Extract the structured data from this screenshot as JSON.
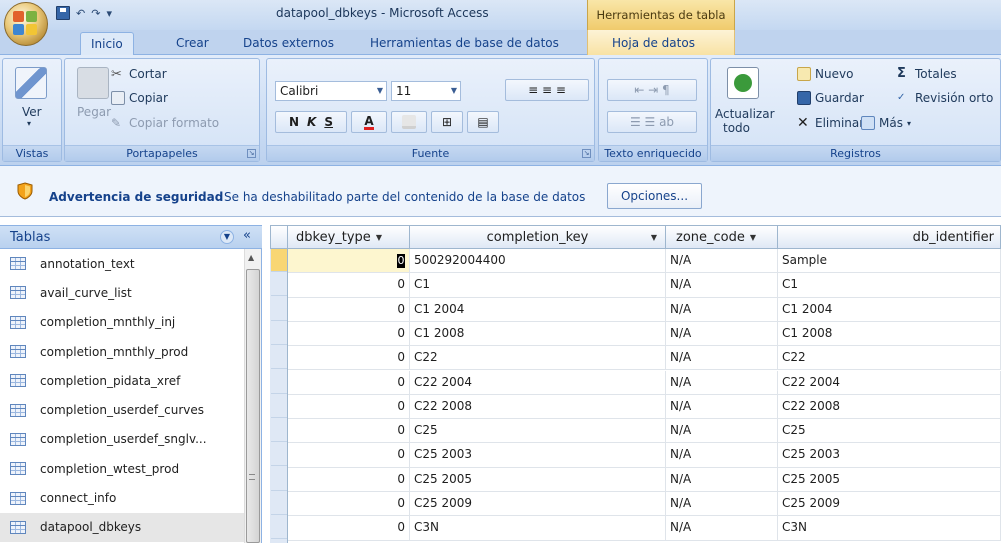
{
  "window": {
    "title": "datapool_dbkeys - Microsoft Access",
    "context_tab_title": "Herramientas de tabla"
  },
  "tabs": [
    {
      "label": "Inicio",
      "active": true
    },
    {
      "label": "Crear"
    },
    {
      "label": "Datos externos"
    },
    {
      "label": "Herramientas de base de datos"
    },
    {
      "label": "Hoja de datos"
    }
  ],
  "ribbon": {
    "vistas": {
      "label": "Vistas",
      "ver": "Ver"
    },
    "portapapeles": {
      "label": "Portapapeles",
      "pegar": "Pegar",
      "cortar": "Cortar",
      "copiar": "Copiar",
      "copiar_formato": "Copiar formato"
    },
    "fuente": {
      "label": "Fuente",
      "font": "Calibri",
      "size": "11",
      "bold": "N",
      "italic": "K",
      "underline": "S",
      "font_color": "A"
    },
    "texto": {
      "label": "Texto enriquecido"
    },
    "registros": {
      "label": "Registros",
      "actualizar": "Actualizar",
      "todo": "todo",
      "nuevo": "Nuevo",
      "guardar": "Guardar",
      "eliminar": "Eliminar",
      "totales": "Totales",
      "revision": "Revisión orto",
      "mas": "Más"
    }
  },
  "security": {
    "title": "Advertencia de seguridad",
    "message": "Se ha deshabilitado parte del contenido de la base de datos",
    "button": "Opciones..."
  },
  "nav": {
    "title": "Tablas",
    "collapse": "«",
    "items": [
      {
        "label": "annotation_text"
      },
      {
        "label": "avail_curve_list"
      },
      {
        "label": "completion_mnthly_inj"
      },
      {
        "label": "completion_mnthly_prod"
      },
      {
        "label": "completion_pidata_xref"
      },
      {
        "label": "completion_userdef_curves"
      },
      {
        "label": "completion_userdef_snglv..."
      },
      {
        "label": "completion_wtest_prod"
      },
      {
        "label": "connect_info"
      },
      {
        "label": "datapool_dbkeys",
        "selected": true
      }
    ]
  },
  "sheet": {
    "columns": [
      "dbkey_type",
      "completion_key",
      "zone_code",
      "db_identifier"
    ],
    "rows": [
      [
        "0",
        "500292004400",
        "N/A",
        "Sample"
      ],
      [
        "0",
        "C1",
        "N/A",
        "C1"
      ],
      [
        "0",
        "C1 2004",
        "N/A",
        "C1 2004"
      ],
      [
        "0",
        "C1 2008",
        "N/A",
        "C1 2008"
      ],
      [
        "0",
        "C22",
        "N/A",
        "C22"
      ],
      [
        "0",
        "C22 2004",
        "N/A",
        "C22 2004"
      ],
      [
        "0",
        "C22 2008",
        "N/A",
        "C22 2008"
      ],
      [
        "0",
        "C25",
        "N/A",
        "C25"
      ],
      [
        "0",
        "C25 2003",
        "N/A",
        "C25 2003"
      ],
      [
        "0",
        "C25 2005",
        "N/A",
        "C25 2005"
      ],
      [
        "0",
        "C25 2009",
        "N/A",
        "C25 2009"
      ],
      [
        "0",
        "C3N",
        "N/A",
        "C3N"
      ]
    ]
  }
}
